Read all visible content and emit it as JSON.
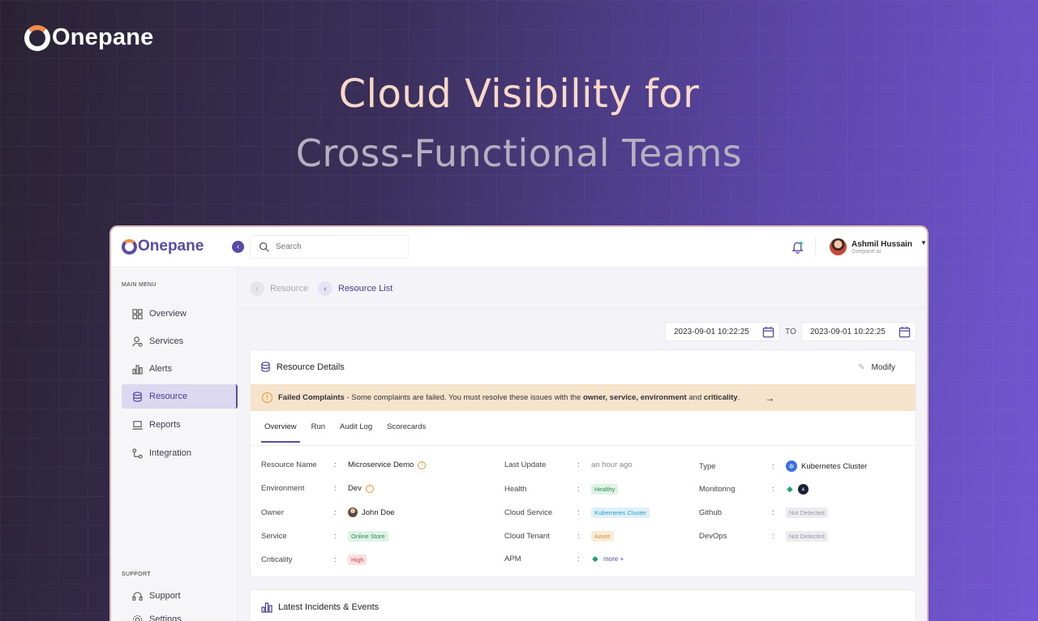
{
  "brand": {
    "name": "Onepane"
  },
  "hero": {
    "line1": "Cloud Visibility for",
    "line2": "Cross-Functional Teams"
  },
  "app": {
    "logo": "Onepane",
    "search": {
      "placeholder": "Search"
    },
    "user": {
      "name": "Ashmil Hussain",
      "org": "Onepane.ai"
    },
    "sidebar": {
      "main_menu_label": "MAIN MENU",
      "items": [
        {
          "label": "Overview",
          "icon": "grid-icon"
        },
        {
          "label": "Services",
          "icon": "user-gear-icon"
        },
        {
          "label": "Alerts",
          "icon": "bar-chart-icon"
        },
        {
          "label": "Resource",
          "icon": "database-icon",
          "active": true
        },
        {
          "label": "Reports",
          "icon": "laptop-icon"
        },
        {
          "label": "Integration",
          "icon": "integration-icon"
        }
      ],
      "support_label": "SUPPORT",
      "support_items": [
        {
          "label": "Support",
          "icon": "headset-icon"
        },
        {
          "label": "Settings",
          "icon": "gear-icon"
        }
      ]
    },
    "breadcrumb": {
      "item1": "Resource",
      "item2": "Resource List"
    },
    "date_range": {
      "from": "2023-09-01  10:22:25",
      "to_label": "TO",
      "to": "2023-09-01  10:22:25"
    },
    "resource_card": {
      "title": "Resource Details",
      "modify_label": "Modify",
      "banner": {
        "bold": "Failed Complaints",
        "text_a": " - Some complaints are failed. You must resolve these issues with the ",
        "bold2": "owner, service, environment",
        "text_b": " and ",
        "bold3": "criticality",
        "text_c": "."
      },
      "tabs": [
        "Overview",
        "Run",
        "Audit Log",
        "Scorecards"
      ],
      "fields": {
        "resource_name": {
          "label": "Resource Name",
          "value": "Microservice Demo"
        },
        "environment": {
          "label": "Environment",
          "value": "Dev"
        },
        "owner": {
          "label": "Owner",
          "value": "John Doe"
        },
        "service": {
          "label": "Service",
          "value": "Online Store"
        },
        "criticality": {
          "label": "Criticality",
          "value": "High"
        },
        "last_update": {
          "label": "Last Update",
          "value": "an hour ago"
        },
        "health": {
          "label": "Health",
          "value": "Healthy"
        },
        "cloud_service": {
          "label": "Cloud Service",
          "value": "Kubernetes Cluster"
        },
        "cloud_tenant": {
          "label": "Cloud Tenant",
          "value": "Azure"
        },
        "apm": {
          "label": "APM",
          "value": "more +"
        },
        "type": {
          "label": "Type",
          "value": "Kubernetes Cluster"
        },
        "monitoring": {
          "label": "Monitoring",
          "value": ""
        },
        "github": {
          "label": "Github",
          "value": "Not Detected"
        },
        "devops": {
          "label": "DevOps",
          "value": "Not Detected"
        }
      },
      "colon": ":"
    },
    "incidents_card": {
      "title": "Latest Incidents & Events"
    }
  },
  "colors": {
    "accent": "#5a4aa8",
    "warning_bg": "#f5e3cc",
    "hero_peach": "#f8d8c8"
  }
}
